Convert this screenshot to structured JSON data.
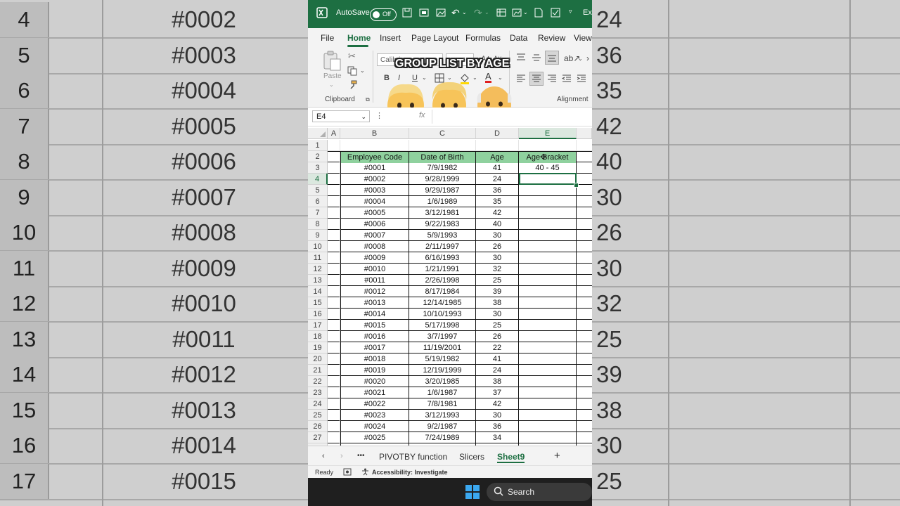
{
  "background": {
    "rows": [
      {
        "num": "4",
        "code": "#0002",
        "right": "24"
      },
      {
        "num": "5",
        "code": "#0003",
        "right": "36"
      },
      {
        "num": "6",
        "code": "#0004",
        "right": "35"
      },
      {
        "num": "7",
        "code": "#0005",
        "right": "42"
      },
      {
        "num": "8",
        "code": "#0006",
        "right": "40"
      },
      {
        "num": "9",
        "code": "#0007",
        "right": "30"
      },
      {
        "num": "10",
        "code": "#0008",
        "right": "26"
      },
      {
        "num": "11",
        "code": "#0009",
        "right": "30"
      },
      {
        "num": "12",
        "code": "#0010",
        "right": "32"
      },
      {
        "num": "13",
        "code": "#0011",
        "right": "25"
      },
      {
        "num": "14",
        "code": "#0012",
        "right": "39"
      },
      {
        "num": "15",
        "code": "#0013",
        "right": "38"
      },
      {
        "num": "16",
        "code": "#0014",
        "right": "30"
      },
      {
        "num": "17",
        "code": "#0015",
        "right": "25"
      }
    ]
  },
  "titlebar": {
    "autosave_label": "AutoSave",
    "toggle_state": "Off",
    "app_suffix": "Ex"
  },
  "menu": {
    "items": [
      "File",
      "Home",
      "Insert",
      "Page Layout",
      "Formulas",
      "Data",
      "Review",
      "View"
    ],
    "active": "Home"
  },
  "ribbon": {
    "paste_label": "Paste",
    "clipboard_label": "Clipboard",
    "font_name": "Calibri",
    "alignment_label": "Alignment",
    "bold": "B",
    "italic": "I",
    "underline": "U",
    "font_color_letter": "A"
  },
  "overlay": {
    "title": "GROUP LIST BY AGE",
    "faces": [
      "child",
      "adult",
      "elder"
    ]
  },
  "formula_bar": {
    "cell_ref": "E4",
    "fx": "fx"
  },
  "columns": [
    "A",
    "B",
    "C",
    "D",
    "E"
  ],
  "selected_column": "E",
  "selected_row": "4",
  "table": {
    "headers": [
      "Employee Code",
      "Date of Birth",
      "Age",
      "Age Bracket"
    ],
    "rows": [
      [
        "#0001",
        "7/9/1982",
        "41",
        "40 - 45"
      ],
      [
        "#0002",
        "9/28/1999",
        "24",
        ""
      ],
      [
        "#0003",
        "9/29/1987",
        "36",
        ""
      ],
      [
        "#0004",
        "1/6/1989",
        "35",
        ""
      ],
      [
        "#0005",
        "3/12/1981",
        "42",
        ""
      ],
      [
        "#0006",
        "9/22/1983",
        "40",
        ""
      ],
      [
        "#0007",
        "5/9/1993",
        "30",
        ""
      ],
      [
        "#0008",
        "2/11/1997",
        "26",
        ""
      ],
      [
        "#0009",
        "6/16/1993",
        "30",
        ""
      ],
      [
        "#0010",
        "1/21/1991",
        "32",
        ""
      ],
      [
        "#0011",
        "2/26/1998",
        "25",
        ""
      ],
      [
        "#0012",
        "8/17/1984",
        "39",
        ""
      ],
      [
        "#0013",
        "12/14/1985",
        "38",
        ""
      ],
      [
        "#0014",
        "10/10/1993",
        "30",
        ""
      ],
      [
        "#0015",
        "5/17/1998",
        "25",
        ""
      ],
      [
        "#0016",
        "3/7/1997",
        "26",
        ""
      ],
      [
        "#0017",
        "11/19/2001",
        "22",
        ""
      ],
      [
        "#0018",
        "5/19/1982",
        "41",
        ""
      ],
      [
        "#0019",
        "12/19/1999",
        "24",
        ""
      ],
      [
        "#0020",
        "3/20/1985",
        "38",
        ""
      ],
      [
        "#0021",
        "1/6/1987",
        "37",
        ""
      ],
      [
        "#0022",
        "7/8/1981",
        "42",
        ""
      ],
      [
        "#0023",
        "3/12/1993",
        "30",
        ""
      ],
      [
        "#0024",
        "9/2/1987",
        "36",
        ""
      ],
      [
        "#0025",
        "7/24/1989",
        "34",
        ""
      ]
    ]
  },
  "sheet_tabs": {
    "items": [
      "PIVOTBY function",
      "Slicers",
      "Sheet9"
    ],
    "active": "Sheet9",
    "more": "•••",
    "add": "+"
  },
  "status": {
    "ready": "Ready",
    "accessibility": "Accessibility: Investigate"
  },
  "taskbar": {
    "search_label": "Search"
  },
  "colors": {
    "excel_green": "#1d6f42",
    "header_fill": "#8fd19e"
  }
}
